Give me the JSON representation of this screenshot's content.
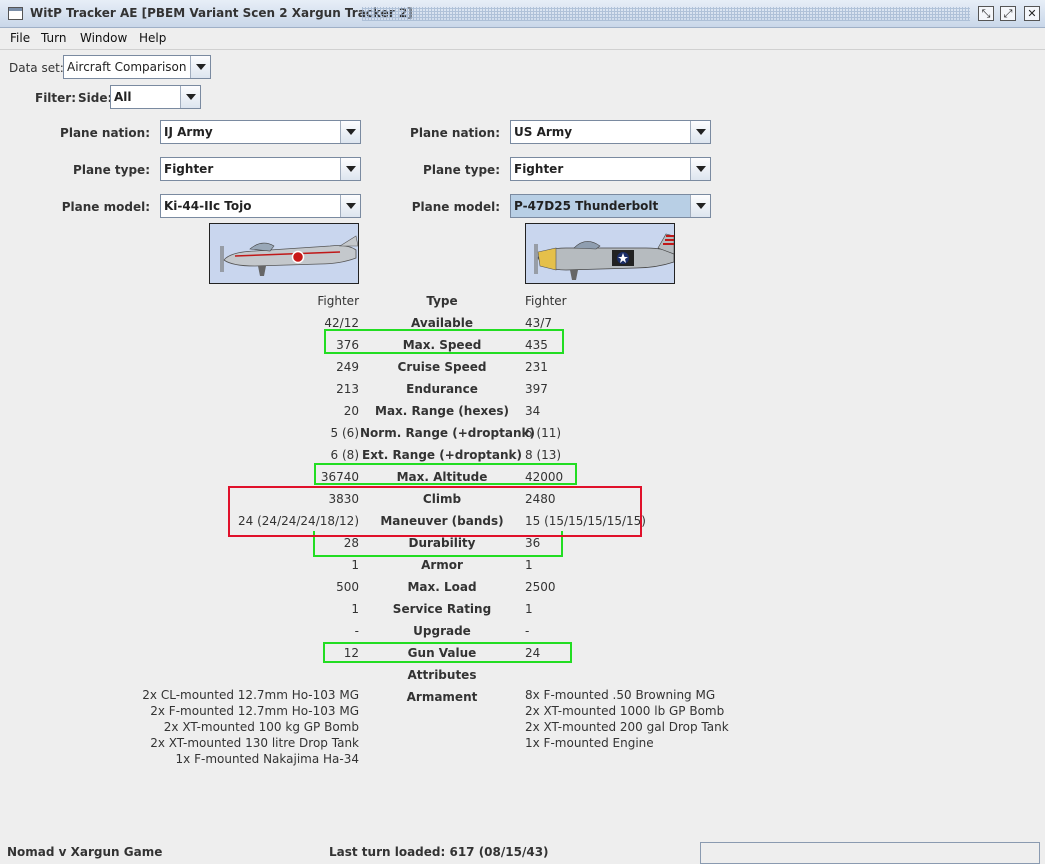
{
  "window": {
    "title": "WitP Tracker AE [PBEM Variant Scen 2 Xargun Tracker 2]"
  },
  "menu": [
    "File",
    "Turn",
    "Window",
    "Help"
  ],
  "dataset": {
    "label": "Data set:",
    "value": "Aircraft Comparison"
  },
  "filter": {
    "label": "Filter:",
    "side_label": "Side:",
    "side_value": "All"
  },
  "left": {
    "nation_label": "Plane nation:",
    "nation": "IJ Army",
    "type_label": "Plane type:",
    "type": "Fighter",
    "model_label": "Plane model:",
    "model": "Ki-44-IIc Tojo"
  },
  "right": {
    "nation_label": "Plane nation:",
    "nation": "US Army",
    "type_label": "Plane type:",
    "type": "Fighter",
    "model_label": "Plane model:",
    "model": "P-47D25 Thunderbolt"
  },
  "stats": [
    {
      "label": "Type",
      "left": "Fighter",
      "right": "Fighter"
    },
    {
      "label": "Available",
      "left": "42/12",
      "right": "43/7"
    },
    {
      "label": "Max. Speed",
      "left": "376",
      "right": "435"
    },
    {
      "label": "Cruise Speed",
      "left": "249",
      "right": "231"
    },
    {
      "label": "Endurance",
      "left": "213",
      "right": "397"
    },
    {
      "label": "Max. Range (hexes)",
      "left": "20",
      "right": "34"
    },
    {
      "label": "Norm. Range (+droptank)",
      "left": "5 (6)",
      "right": "6 (11)"
    },
    {
      "label": "Ext. Range (+droptank)",
      "left": "6 (8)",
      "right": "8 (13)"
    },
    {
      "label": "Max. Altitude",
      "left": "36740",
      "right": "42000"
    },
    {
      "label": "Climb",
      "left": "3830",
      "right": "2480"
    },
    {
      "label": "Maneuver (bands)",
      "left": "24 (24/24/24/18/12)",
      "right": "15 (15/15/15/15/15)"
    },
    {
      "label": "Durability",
      "left": "28",
      "right": "36"
    },
    {
      "label": "Armor",
      "left": "1",
      "right": "1"
    },
    {
      "label": "Max. Load",
      "left": "500",
      "right": "2500"
    },
    {
      "label": "Service Rating",
      "left": "1",
      "right": "1"
    },
    {
      "label": "Upgrade",
      "left": "-",
      "right": "-"
    },
    {
      "label": "Gun Value",
      "left": "12",
      "right": "24"
    },
    {
      "label": "Attributes",
      "left": "",
      "right": ""
    }
  ],
  "armament": {
    "label": "Armament",
    "left": [
      "2x CL-mounted 12.7mm Ho-103 MG",
      "2x F-mounted 12.7mm Ho-103 MG",
      "2x XT-mounted 100 kg GP Bomb",
      "2x XT-mounted 130 litre Drop Tank",
      "1x F-mounted Nakajima Ha-34"
    ],
    "right": [
      "8x F-mounted .50 Browning MG",
      "2x XT-mounted 1000 lb GP Bomb",
      "2x XT-mounted 200 gal Drop Tank",
      "1x F-mounted Engine"
    ]
  },
  "status": {
    "game": "Nomad v Xargun Game",
    "last_turn": "Last turn loaded: 617 (08/15/43)"
  },
  "colors": {
    "highlight_green": "#22dd22",
    "highlight_red": "#e0102a",
    "selected_combo": "#b8cfe5"
  }
}
